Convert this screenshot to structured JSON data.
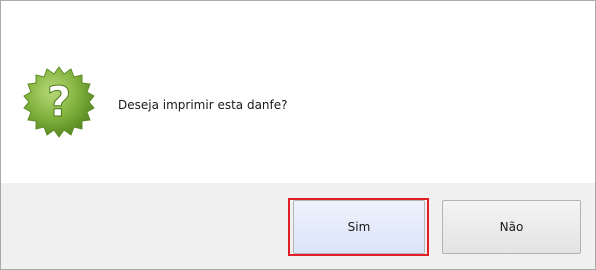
{
  "dialog": {
    "message": "Deseja imprimir esta danfe?",
    "icon": "question-badge-icon",
    "icon_color": "#6f9d2c"
  },
  "buttons": {
    "yes_label": "Sim",
    "no_label": "Não",
    "focused": "Sim",
    "focus_color": "#e01e26"
  }
}
